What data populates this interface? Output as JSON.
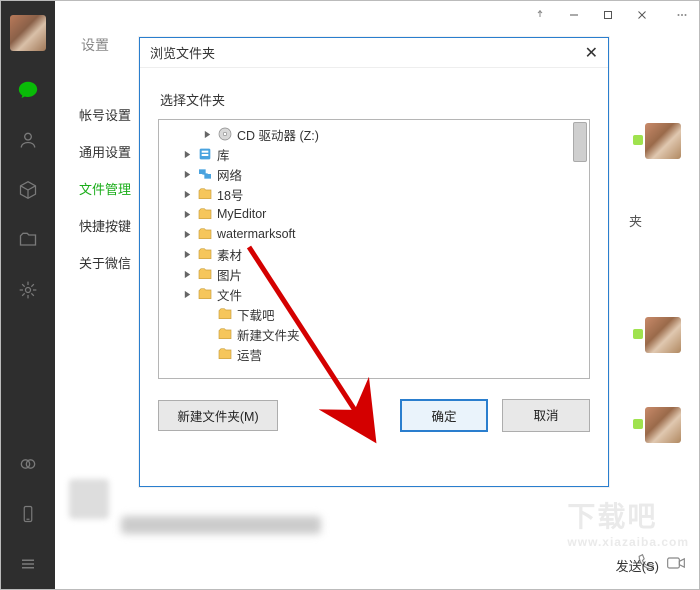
{
  "titlebar": {
    "pin_icon": "pin",
    "minimize_icon": "minimize",
    "maximize_icon": "maximize",
    "close_icon": "close",
    "more_icon": "more"
  },
  "leftbar": {
    "chat_icon": "chat-bubble",
    "contacts_icon": "person",
    "favorites_icon": "cube",
    "files_icon": "folder",
    "moments_icon": "flower",
    "miniapp_icon": "circle-ring",
    "phone_icon": "phone",
    "menu_icon": "menu"
  },
  "settings": {
    "title": "设置",
    "nav": {
      "account": "帐号设置",
      "general": "通用设置",
      "files": "文件管理",
      "shortcut": "快捷按键",
      "about": "关于微信"
    }
  },
  "dialog": {
    "title": "浏览文件夹",
    "subtitle": "选择文件夹",
    "tree": [
      {
        "indent": 1,
        "expander": true,
        "icon": "cd",
        "label": "CD 驱动器 (Z:)"
      },
      {
        "indent": 0,
        "expander": true,
        "icon": "library",
        "label": "库"
      },
      {
        "indent": 0,
        "expander": true,
        "icon": "network",
        "label": "网络"
      },
      {
        "indent": 0,
        "expander": true,
        "icon": "folder",
        "label": "18号"
      },
      {
        "indent": 0,
        "expander": true,
        "icon": "folder",
        "label": "MyEditor"
      },
      {
        "indent": 0,
        "expander": true,
        "icon": "folder",
        "label": "watermarksoft"
      },
      {
        "indent": 0,
        "expander": true,
        "icon": "folder",
        "label": "素材"
      },
      {
        "indent": 0,
        "expander": true,
        "icon": "folder",
        "label": "图片"
      },
      {
        "indent": 0,
        "expander": true,
        "icon": "folder",
        "label": "文件"
      },
      {
        "indent": 1,
        "expander": false,
        "icon": "folder",
        "label": "下载吧"
      },
      {
        "indent": 1,
        "expander": false,
        "icon": "folder",
        "label": "新建文件夹"
      },
      {
        "indent": 1,
        "expander": false,
        "icon": "folder",
        "label": "运营"
      }
    ],
    "buttons": {
      "new_folder": "新建文件夹(M)",
      "ok": "确定",
      "cancel": "取消"
    }
  },
  "right_labels": {
    "folder_hint": "夹"
  },
  "bottom": {
    "send": "发送(S)"
  },
  "watermark": {
    "big": "下载吧",
    "small": "www.xiazaiba.com"
  }
}
